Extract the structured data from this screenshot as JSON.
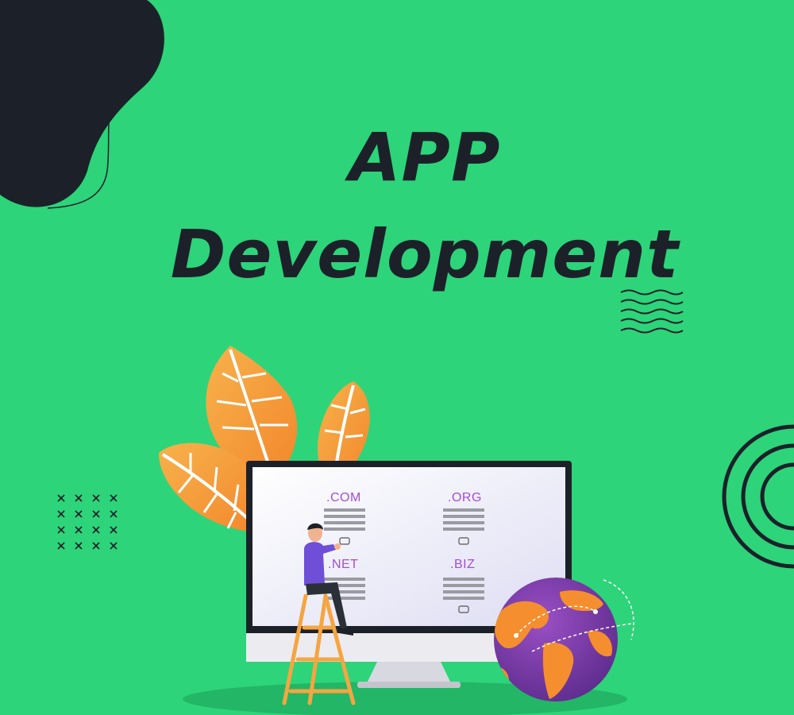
{
  "colors": {
    "background": "#2dd47a",
    "dark": "#1c2129",
    "leaf": "#f59a3a",
    "screen": "#e8e8f7",
    "purple_text": "#a24fd0",
    "globe_ocean": "#7a3aa3",
    "globe_land": "#f58e2e"
  },
  "heading": {
    "line1": "APP",
    "line2": "Development"
  },
  "domains": [
    {
      "label": ".COM"
    },
    {
      "label": ".ORG"
    },
    {
      "label": ".NET"
    },
    {
      "label": ".BIZ"
    }
  ],
  "icons": [
    "blob-shape",
    "wave-lines",
    "x-pattern",
    "concentric-circles",
    "leaf",
    "monitor",
    "person",
    "ladder",
    "globe"
  ]
}
